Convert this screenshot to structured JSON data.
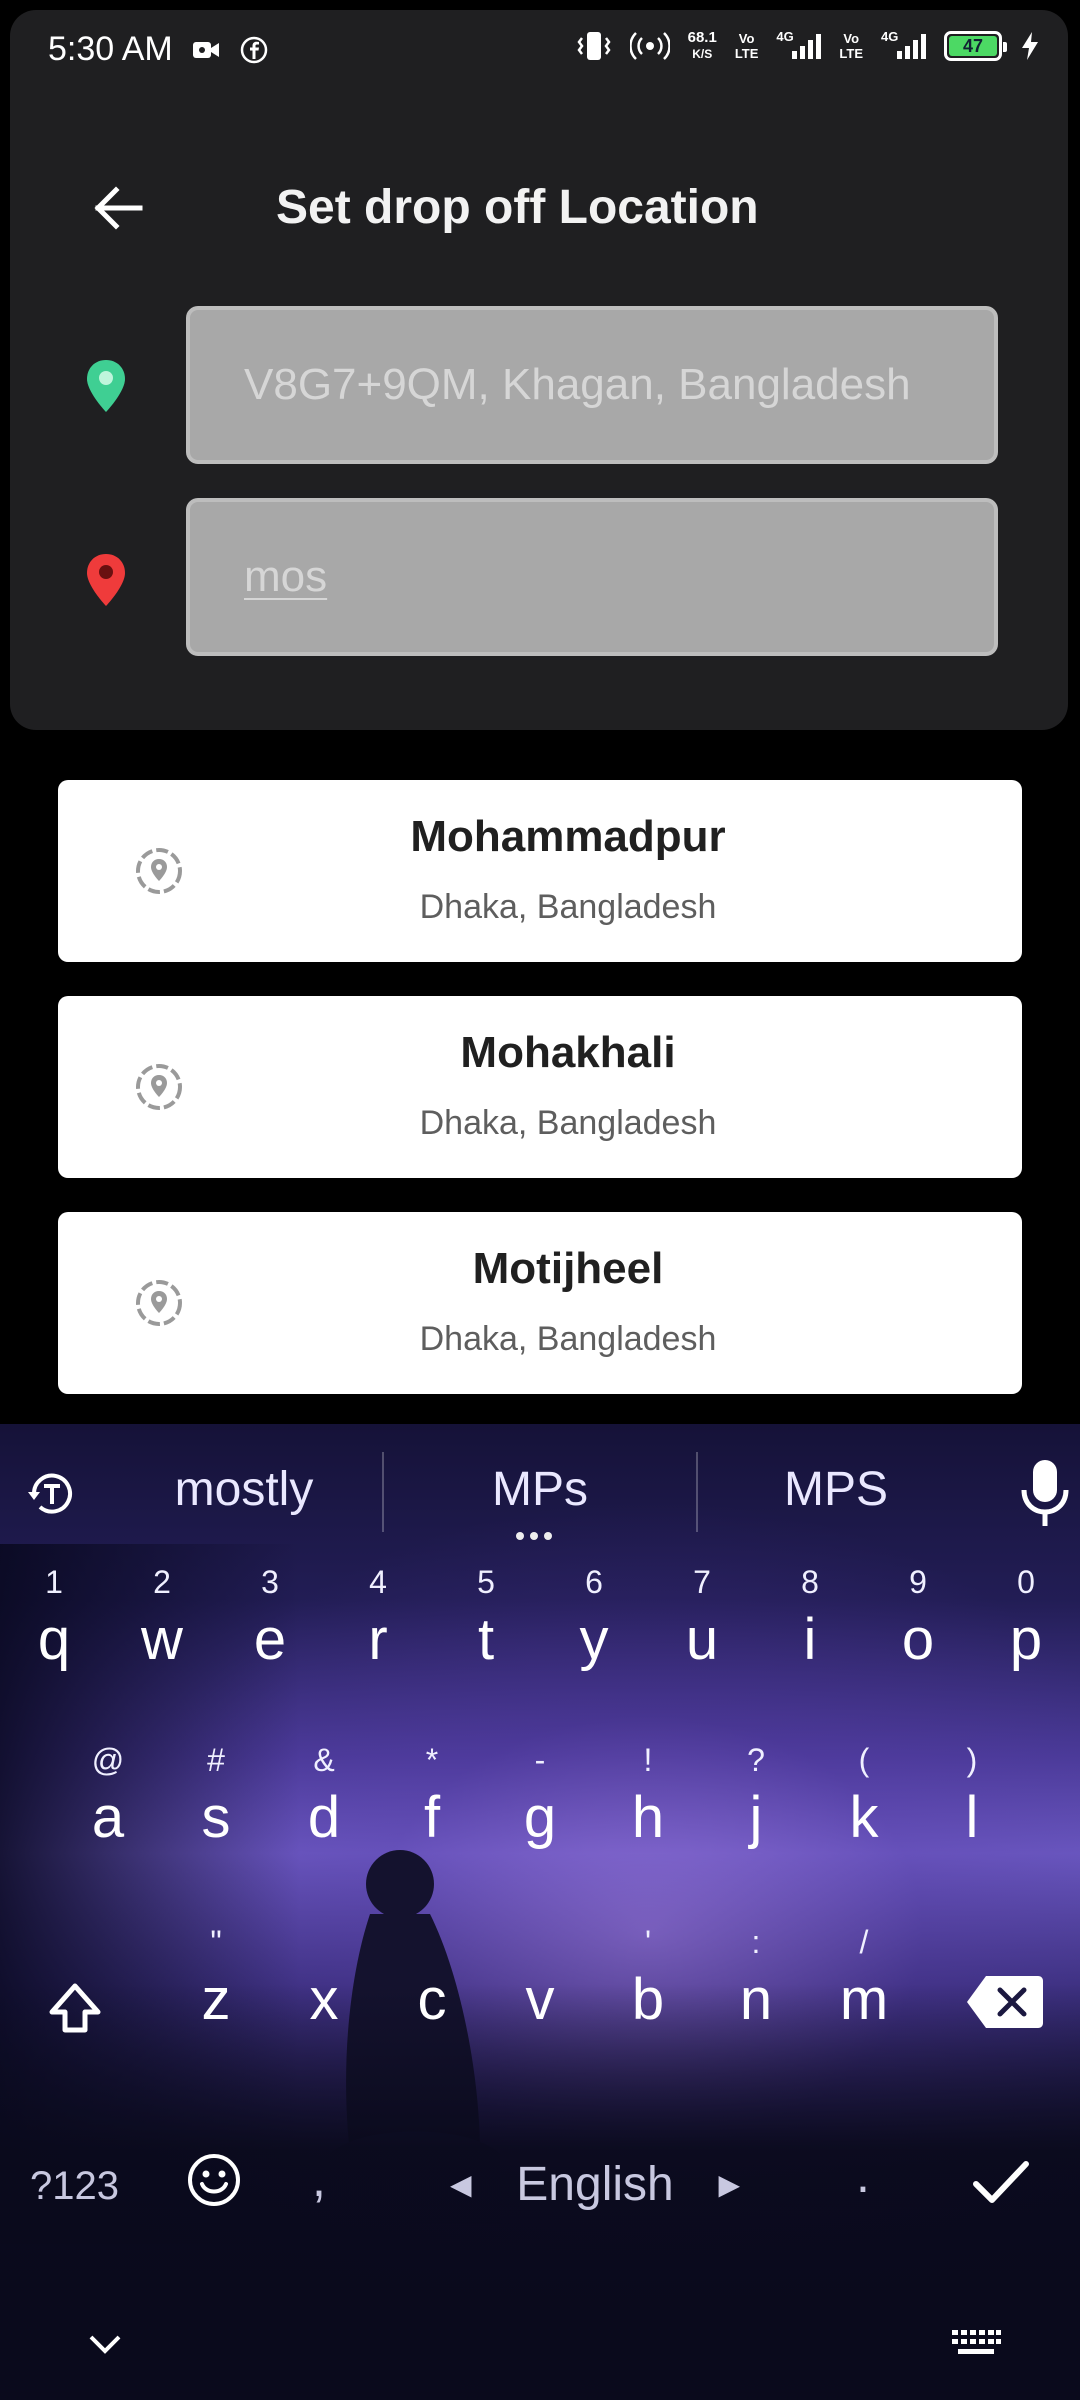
{
  "status_bar": {
    "time": "5:30 AM",
    "net_speed_value": "68.1",
    "net_speed_unit": "K/S",
    "volte1_top": "Vo",
    "volte1_bottom": "LTE",
    "network1": "4G",
    "volte2_top": "Vo",
    "volte2_bottom": "LTE",
    "network2": "4G",
    "battery": "47"
  },
  "header": {
    "title": "Set drop off Location"
  },
  "fields": {
    "pickup_value": "V8G7+9QM, Khagan, Bangladesh",
    "drop_value": "mos"
  },
  "suggestions": [
    {
      "title": "Mohammadpur",
      "subtitle": "Dhaka, Bangladesh"
    },
    {
      "title": "Mohakhali",
      "subtitle": "Dhaka, Bangladesh"
    },
    {
      "title": "Motijheel",
      "subtitle": "Dhaka, Bangladesh"
    }
  ],
  "keyboard": {
    "word_suggestions": [
      "mostly",
      "MPs",
      "MPS"
    ],
    "row1": [
      {
        "hint": "1",
        "key": "q"
      },
      {
        "hint": "2",
        "key": "w"
      },
      {
        "hint": "3",
        "key": "e"
      },
      {
        "hint": "4",
        "key": "r"
      },
      {
        "hint": "5",
        "key": "t"
      },
      {
        "hint": "6",
        "key": "y"
      },
      {
        "hint": "7",
        "key": "u"
      },
      {
        "hint": "8",
        "key": "i"
      },
      {
        "hint": "9",
        "key": "o"
      },
      {
        "hint": "0",
        "key": "p"
      }
    ],
    "row2": [
      {
        "hint": "@",
        "key": "a"
      },
      {
        "hint": "#",
        "key": "s"
      },
      {
        "hint": "&",
        "key": "d"
      },
      {
        "hint": "*",
        "key": "f"
      },
      {
        "hint": "-",
        "key": "g"
      },
      {
        "hint": "!",
        "key": "h"
      },
      {
        "hint": "?",
        "key": "j"
      },
      {
        "hint": "(",
        "key": "k"
      },
      {
        "hint": ")",
        "key": "l"
      }
    ],
    "row3": [
      {
        "hint": "\"",
        "key": "z"
      },
      {
        "hint": "",
        "key": "x"
      },
      {
        "hint": "",
        "key": "c"
      },
      {
        "hint": "",
        "key": "v"
      },
      {
        "hint": "'",
        "key": "b"
      },
      {
        "hint": ":",
        "key": "n"
      },
      {
        "hint": "/",
        "key": "m"
      }
    ],
    "num_key": "?123",
    "comma": ",",
    "language": "English",
    "period": "."
  }
}
